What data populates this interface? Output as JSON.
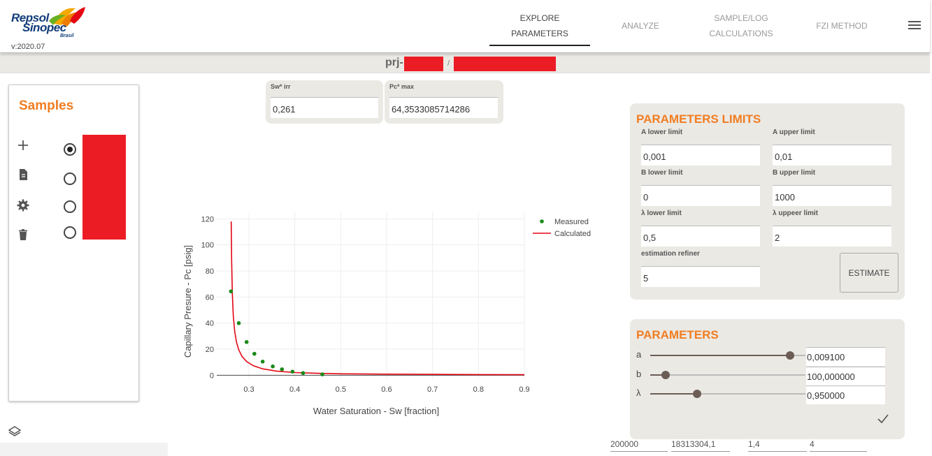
{
  "app": {
    "logo_line1": "Repsol",
    "logo_line2": "Sinopec",
    "logo_line3": "Brasil",
    "version": "v:2020.07"
  },
  "nav": {
    "items": [
      {
        "line1": "EXPLORE",
        "line2": "PARAMETERS",
        "active": true
      },
      {
        "line1": "ANALYZE",
        "line2": "",
        "active": false
      },
      {
        "line1": "SAMPLE/LOG",
        "line2": "CALCULATIONS",
        "active": false
      },
      {
        "line1": "FZI METHOD",
        "line2": "",
        "active": false
      }
    ],
    "menu_icon": "hamburger-menu-icon"
  },
  "project": {
    "prefix": "prj-",
    "separator": "/"
  },
  "samples": {
    "title": "Samples",
    "actions": [
      "add-icon",
      "document-icon",
      "gear-icon",
      "trash-icon"
    ],
    "items_selected": [
      true,
      false,
      false,
      false
    ]
  },
  "fields": {
    "swirr_label": "Sw* irr",
    "swirr_value": "0,261",
    "pcmax_label": "Pc* max",
    "pcmax_value": "64,3533085714286"
  },
  "limits": {
    "title": "PARAMETERS LIMITS",
    "a_lower_label": "A lower limit",
    "a_lower_value": "0,001",
    "a_upper_label": "A upper limit",
    "a_upper_value": "0,01",
    "b_lower_label": "B lower limit",
    "b_lower_value": "0",
    "b_upper_label": "B upper limit",
    "b_upper_value": "1000",
    "l_lower_label": "λ lower limit",
    "l_lower_value": "0,5",
    "l_upper_label": "λ uppeer limit",
    "l_upper_value": "2",
    "refiner_label": "estimation refiner",
    "refiner_value": "5",
    "estimate_label": "ESTIMATE"
  },
  "parameters": {
    "title": "PARAMETERS",
    "a_label": "a",
    "a_value": "0,009100",
    "a_fraction": 0.9,
    "b_label": "b",
    "b_value": "100,000000",
    "b_fraction": 0.1,
    "l_label": "λ",
    "l_value": "0,950000",
    "l_fraction": 0.3
  },
  "bottom_row": {
    "c1": "200000",
    "c2": "18313304,1",
    "c3": "1,4",
    "c4": "4"
  },
  "colors": {
    "accent": "#f07d22",
    "measured": "#1a8a1a",
    "calculated": "#e30613",
    "panel_bg": "#ebe9e4"
  },
  "chart_data": {
    "type": "scatter",
    "xlabel": "Water Saturation - Sw [fraction]",
    "ylabel": "Capillary Presure - Pc [psig]",
    "xlim": [
      0.23,
      0.9
    ],
    "ylim": [
      -3,
      125
    ],
    "x_ticks": [
      0.3,
      0.4,
      0.5,
      0.6,
      0.7,
      0.8,
      0.9
    ],
    "x_tick_labels": [
      "0.3",
      "0.4",
      "0.5",
      "0.6",
      "0.7",
      "0.8",
      "0.9"
    ],
    "y_ticks": [
      0,
      20,
      40,
      60,
      80,
      100,
      120
    ],
    "y_tick_labels": [
      "0",
      "20",
      "40",
      "60",
      "80",
      "100",
      "120"
    ],
    "grid": true,
    "legend_position": "top-right",
    "series": [
      {
        "name": "Measured",
        "kind": "markers",
        "x": [
          0.261,
          0.278,
          0.295,
          0.312,
          0.33,
          0.352,
          0.372,
          0.395,
          0.418,
          0.46
        ],
        "y": [
          64.35,
          40,
          25.5,
          16.5,
          10.5,
          6.8,
          4.6,
          2.8,
          1.7,
          0.7
        ]
      },
      {
        "name": "Calculated",
        "kind": "line",
        "x": [
          0.2615,
          0.2625,
          0.264,
          0.266,
          0.269,
          0.273,
          0.278,
          0.285,
          0.295,
          0.31,
          0.33,
          0.36,
          0.4,
          0.45,
          0.5,
          0.6,
          0.7,
          0.8,
          0.9
        ],
        "y": [
          118,
          88,
          63,
          46,
          34,
          25.5,
          19.5,
          14.5,
          10.5,
          7.3,
          4.9,
          3.2,
          2.1,
          1.5,
          1.15,
          0.85,
          0.7,
          0.55,
          0.45
        ]
      }
    ]
  }
}
